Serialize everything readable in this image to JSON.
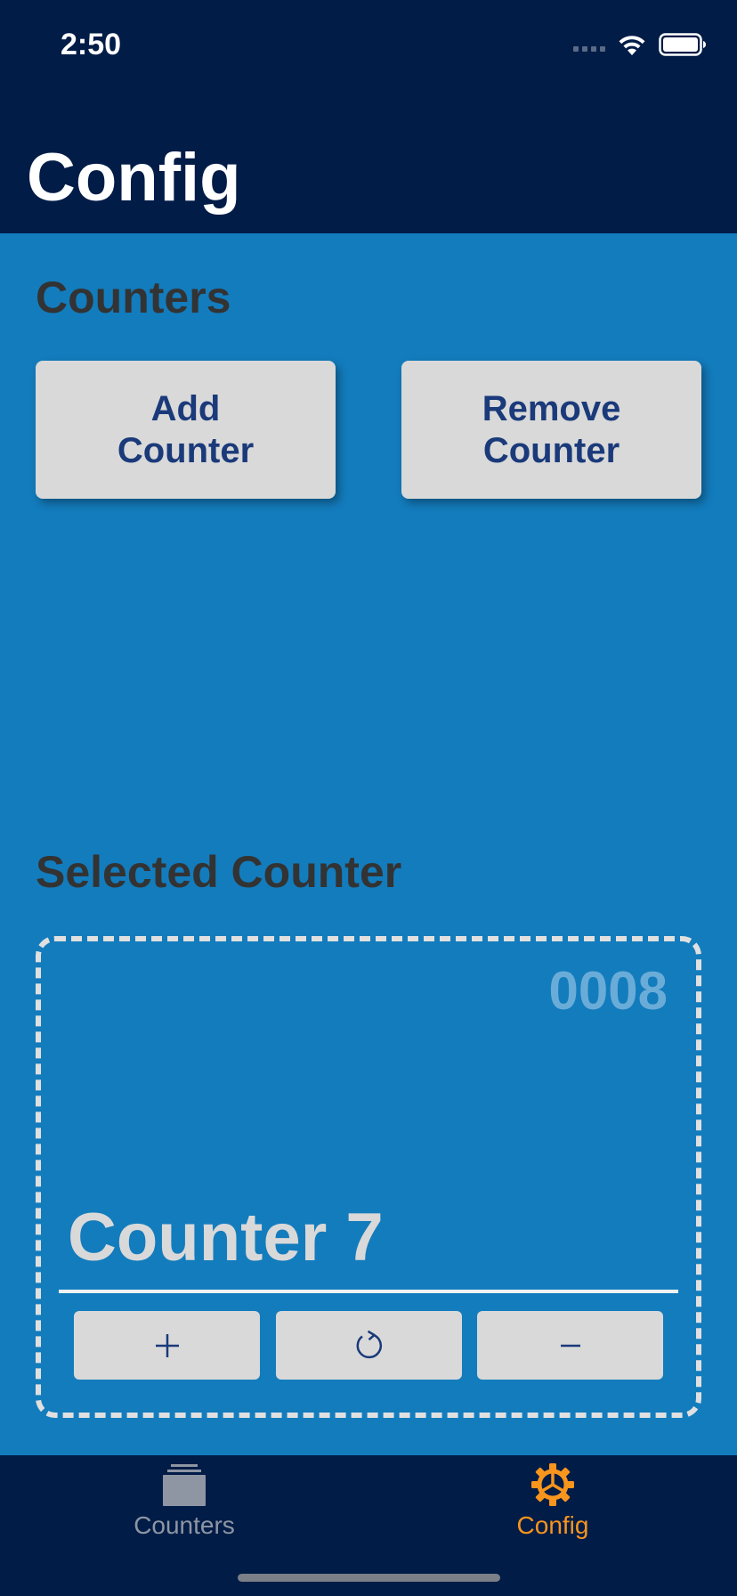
{
  "status_bar": {
    "time": "2:50"
  },
  "header": {
    "title": "Config"
  },
  "counters_section": {
    "title": "Counters",
    "add_button": "Add\nCounter",
    "remove_button": "Remove\nCounter"
  },
  "selected_section": {
    "title": "Selected Counter",
    "count": "0008",
    "name": "Counter 7",
    "controls": {
      "increment_icon": "plus-icon",
      "reset_icon": "refresh-icon",
      "decrement_icon": "minus-icon"
    }
  },
  "tab_bar": {
    "tabs": [
      {
        "label": "Counters",
        "icon": "stack-icon",
        "active": false,
        "color": "#8e95a3"
      },
      {
        "label": "Config",
        "icon": "gear-icon",
        "active": true,
        "color": "#f7951d"
      }
    ]
  },
  "colors": {
    "header_bg": "#011c47",
    "content_bg": "#137cbd",
    "button_bg": "#d9d9d9",
    "button_text": "#1a3a7a",
    "accent": "#f7951d"
  }
}
